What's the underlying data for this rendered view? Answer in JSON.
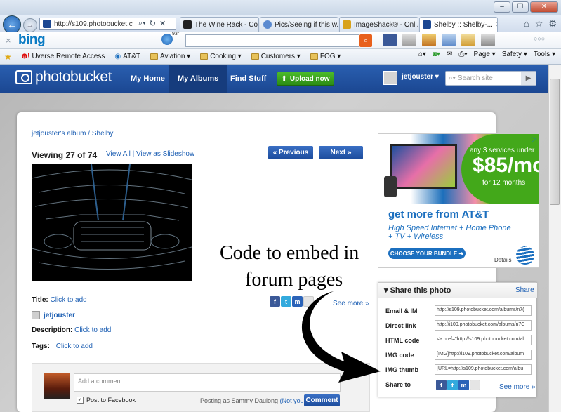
{
  "browser": {
    "address": "http://s109.photobucket.c",
    "tabs": [
      {
        "label": "The Wine Rack - Con..."
      },
      {
        "label": "Pics/Seeing if this w..."
      },
      {
        "label": "ImageShack® - Onli..."
      },
      {
        "label": "Shelby :: Shelby-..."
      }
    ],
    "toolbar": {
      "weather": "93°"
    },
    "favorites": [
      {
        "label": "Uverse Remote Access"
      },
      {
        "label": "AT&T"
      },
      {
        "label": "Aviation ▾"
      },
      {
        "label": "Cooking ▾"
      },
      {
        "label": "Customers ▾"
      },
      {
        "label": "FOG ▾"
      }
    ],
    "commands": {
      "page": "Page ▾",
      "safety": "Safety ▾",
      "tools": "Tools ▾"
    }
  },
  "site": {
    "logo": "photobucket",
    "nav": {
      "home": "My Home",
      "albums": "My Albums",
      "find": "Find Stuff",
      "upload": "Upload now"
    },
    "user": "jetjouster ▾",
    "search_placeholder": "Search site"
  },
  "album": {
    "breadcrumb": "jetjouster's album / Shelby",
    "viewing": "Viewing 27 of 74",
    "view_all": "View All | View as Slideshow",
    "prev": "« Previous",
    "next": "Next »"
  },
  "details": {
    "title_label": "Title:",
    "title_value": "Click to add",
    "owner": "jetjouster",
    "desc_label": "Description:",
    "desc_value": "Click to add",
    "tags_label": "Tags:",
    "tags_value": "Click to add",
    "see_more": "See more »"
  },
  "comment": {
    "placeholder": "Add a comment...",
    "post_fb": "Post to Facebook",
    "posting_as": "Posting as Sammy Daulong",
    "not_you": "(Not you?)",
    "button": "Comment"
  },
  "ad": {
    "line1": "any 3 services under",
    "price": "$85/mo",
    "line2": "for 12 months",
    "headline": "get more from AT&T",
    "sub1": "High Speed Internet + Home Phone",
    "sub2": "+ TV + Wireless",
    "button": "CHOOSE YOUR BUNDLE ➔",
    "details": "Details"
  },
  "share": {
    "title": "▾ Share this photo",
    "share_link": "Share",
    "rows": [
      {
        "label": "Email & IM",
        "value": "http://s109.photobucket.com/albums/n7("
      },
      {
        "label": "Direct link",
        "value": "http://i109.photobucket.com/albums/n7C"
      },
      {
        "label": "HTML code",
        "value": "<a href=\"http://s109.photobucket.com/al"
      },
      {
        "label": "IMG code",
        "value": "[IMG]http://i109.photobucket.com/album"
      },
      {
        "label": "IMG thumb",
        "value": "[URL=http://s109.photobucket.com/albu"
      }
    ],
    "share_to": "Share to",
    "see_more": "See more »"
  },
  "annotation": {
    "line1": "Code to embed in",
    "line2": "forum pages"
  }
}
